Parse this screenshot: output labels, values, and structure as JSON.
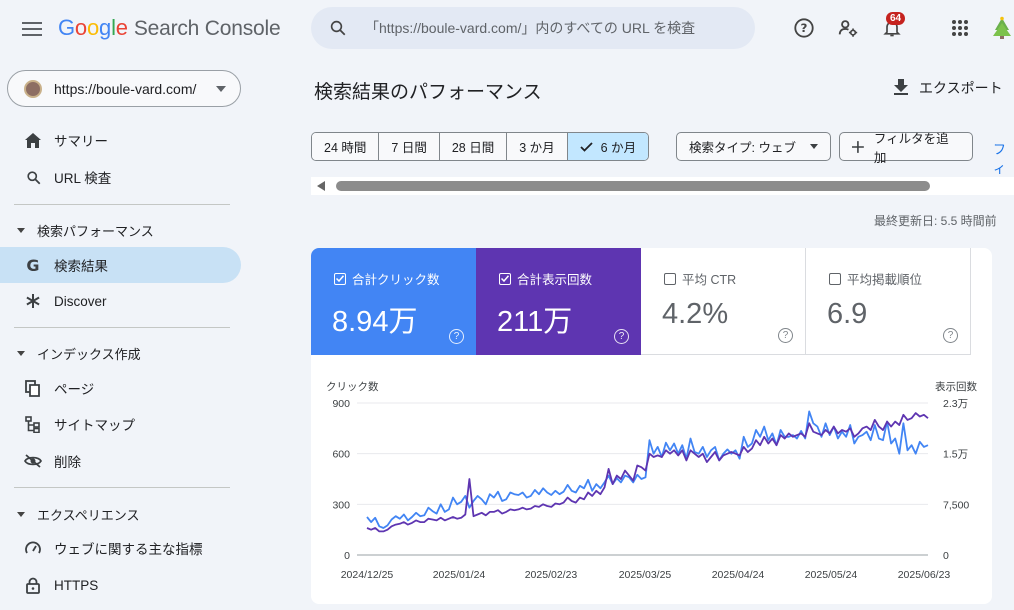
{
  "header": {
    "logo_google": [
      "G",
      "o",
      "o",
      "g",
      "l",
      "e"
    ],
    "logo_product": "Search Console",
    "search_placeholder": "「https://boule-vard.com/」内のすべての URL を検査",
    "notifications_count": "64"
  },
  "sidebar": {
    "property_url": "https://boule-vard.com/",
    "items": {
      "summary": "サマリー",
      "url_inspection": "URL 検査",
      "section_performance": "検索パフォーマンス",
      "search_results": "検索結果",
      "discover": "Discover",
      "section_index": "インデックス作成",
      "pages": "ページ",
      "sitemaps": "サイトマップ",
      "removals": "削除",
      "section_experience": "エクスペリエンス",
      "core_web_vitals": "ウェブに関する主な指標",
      "https": "HTTPS"
    }
  },
  "main": {
    "title": "検索結果のパフォーマンス",
    "export_label": "エクスポート",
    "ranges": [
      "24 時間",
      "7 日間",
      "28 日間",
      "3 か月",
      "6 か月"
    ],
    "selected_range": "6 か月",
    "search_type_label": "検索タイプ: ウェブ",
    "add_filter_label": "フィルタを追加",
    "more_link": "フィ",
    "last_updated": "最終更新日: 5.5 時間前"
  },
  "metrics": {
    "clicks": {
      "label": "合計クリック数",
      "value": "8.94万",
      "checked": true
    },
    "impressions": {
      "label": "合計表示回数",
      "value": "211万",
      "checked": true
    },
    "ctr": {
      "label": "平均 CTR",
      "value": "4.2%",
      "checked": false
    },
    "position": {
      "label": "平均掲載順位",
      "value": "6.9",
      "checked": false
    }
  },
  "colors": {
    "clicks": "#4285f4",
    "impressions": "#5e35b1",
    "accent_selected": "#c2e7ff"
  },
  "chart_data": {
    "type": "line",
    "left_axis_label": "クリック数",
    "right_axis_label": "表示回数",
    "left_ticks": [
      "0",
      "300",
      "600",
      "900"
    ],
    "right_ticks": [
      "0",
      "7,500",
      "1.5万",
      "2.3万"
    ],
    "left_ylim": [
      0,
      900
    ],
    "right_ylim": [
      0,
      23000
    ],
    "x_tick_labels": [
      "2024/12/25",
      "2025/01/24",
      "2025/02/23",
      "2025/03/25",
      "2025/04/24",
      "2025/05/24",
      "2025/06/23"
    ],
    "series": [
      {
        "name": "合計クリック数",
        "axis": "left",
        "color": "#4285f4",
        "values": [
          225,
          195,
          220,
          170,
          160,
          175,
          210,
          230,
          215,
          240,
          205,
          225,
          250,
          230,
          235,
          280,
          260,
          245,
          300,
          255,
          270,
          340,
          300,
          315,
          350,
          280,
          320,
          350,
          330,
          300,
          360,
          340,
          375,
          320,
          330,
          370,
          360,
          355,
          370,
          340,
          350,
          385,
          360,
          395,
          370,
          355,
          380,
          360,
          375,
          415,
          380,
          370,
          410,
          395,
          445,
          380,
          420,
          395,
          430,
          470,
          420,
          455,
          430,
          470,
          460,
          430,
          475,
          450,
          460,
          680,
          600,
          640,
          580,
          665,
          620,
          660,
          600,
          650,
          570,
          690,
          610,
          600,
          640,
          580,
          620,
          640,
          560,
          600,
          625,
          600,
          620,
          570,
          700,
          640,
          660,
          740,
          700,
          760,
          680,
          720,
          650,
          740,
          700,
          700,
          710,
          690,
          735,
          690,
          850,
          780,
          760,
          700,
          780,
          710,
          760,
          690,
          730,
          700,
          770,
          660,
          700,
          710,
          730,
          680,
          770,
          690,
          680,
          790,
          660,
          690,
          600,
          780,
          620,
          650,
          600,
          670,
          640,
          650
        ]
      },
      {
        "name": "合計表示回数",
        "axis": "left",
        "color": "#5e35b1",
        "values": [
          160,
          150,
          160,
          140,
          140,
          150,
          170,
          180,
          185,
          195,
          180,
          190,
          205,
          195,
          195,
          215,
          210,
          205,
          220,
          205,
          215,
          225,
          215,
          220,
          240,
          450,
          230,
          240,
          250,
          235,
          255,
          255,
          265,
          245,
          255,
          270,
          265,
          270,
          280,
          270,
          275,
          290,
          285,
          300,
          290,
          285,
          305,
          300,
          310,
          340,
          320,
          310,
          340,
          330,
          370,
          350,
          380,
          360,
          400,
          510,
          420,
          470,
          450,
          500,
          470,
          440,
          530,
          520,
          500,
          600,
          580,
          590,
          580,
          620,
          600,
          620,
          590,
          620,
          560,
          620,
          600,
          580,
          600,
          550,
          580,
          610,
          560,
          590,
          600,
          610,
          600,
          590,
          640,
          610,
          630,
          680,
          650,
          700,
          660,
          690,
          650,
          710,
          690,
          720,
          700,
          710,
          720,
          700,
          780,
          730,
          720,
          710,
          740,
          720,
          760,
          720,
          740,
          730,
          750,
          700,
          720,
          750,
          760,
          740,
          800,
          760,
          740,
          790,
          760,
          790,
          770,
          830,
          800,
          810,
          840,
          820,
          830,
          810
        ]
      }
    ]
  }
}
